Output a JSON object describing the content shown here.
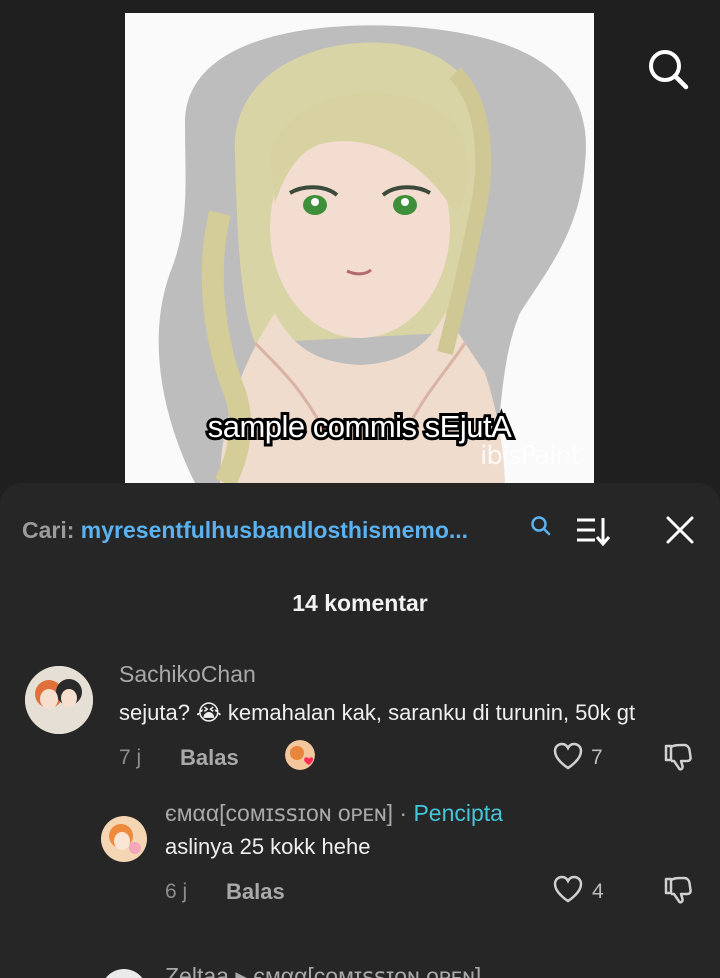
{
  "video": {
    "caption": "sample commis sEjutA",
    "watermark": "ibisPaint"
  },
  "comments_sheet": {
    "search_label": "Cari:",
    "search_query": "myresentfulhusbandlosthismemo...",
    "count_label": "14 komentar",
    "comments": [
      {
        "username": "SachikoChan",
        "text": "sejuta? 😭 kemahalan kak, saranku di turunin, 50k gt",
        "time": "7 j",
        "reply_label": "Balas",
        "likes": "7"
      }
    ],
    "replies": [
      {
        "username": "ємαα[ᴄᴏᴍɪꜱꜱɪᴏɴ ᴏᴘᴇɴ]",
        "separator": "·",
        "creator_badge": "Pencipta",
        "text": "aslinya 25 kokk hehe",
        "time": "6 j",
        "reply_label": "Balas",
        "likes": "4"
      }
    ],
    "partial_reply": {
      "text": "Zeltaa ▸ ємαα[ᴄᴏᴍɪꜱꜱɪᴏɴ ᴏᴘᴇɴ]"
    }
  },
  "colors": {
    "background": "#1f1f1f",
    "sheet": "#262626",
    "link": "#5bb2f0",
    "creator": "#44c6d9"
  }
}
